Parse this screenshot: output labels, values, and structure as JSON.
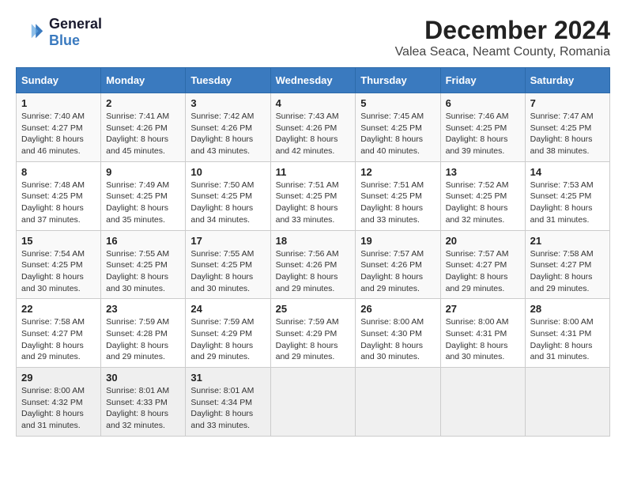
{
  "header": {
    "logo_line1": "General",
    "logo_line2": "Blue",
    "title": "December 2024",
    "subtitle": "Valea Seaca, Neamt County, Romania"
  },
  "weekdays": [
    "Sunday",
    "Monday",
    "Tuesday",
    "Wednesday",
    "Thursday",
    "Friday",
    "Saturday"
  ],
  "weeks": [
    [
      {
        "day": 1,
        "sunrise": "7:40 AM",
        "sunset": "4:27 PM",
        "daylight": "8 hours and 46 minutes."
      },
      {
        "day": 2,
        "sunrise": "7:41 AM",
        "sunset": "4:26 PM",
        "daylight": "8 hours and 45 minutes."
      },
      {
        "day": 3,
        "sunrise": "7:42 AM",
        "sunset": "4:26 PM",
        "daylight": "8 hours and 43 minutes."
      },
      {
        "day": 4,
        "sunrise": "7:43 AM",
        "sunset": "4:26 PM",
        "daylight": "8 hours and 42 minutes."
      },
      {
        "day": 5,
        "sunrise": "7:45 AM",
        "sunset": "4:25 PM",
        "daylight": "8 hours and 40 minutes."
      },
      {
        "day": 6,
        "sunrise": "7:46 AM",
        "sunset": "4:25 PM",
        "daylight": "8 hours and 39 minutes."
      },
      {
        "day": 7,
        "sunrise": "7:47 AM",
        "sunset": "4:25 PM",
        "daylight": "8 hours and 38 minutes."
      }
    ],
    [
      {
        "day": 8,
        "sunrise": "7:48 AM",
        "sunset": "4:25 PM",
        "daylight": "8 hours and 37 minutes."
      },
      {
        "day": 9,
        "sunrise": "7:49 AM",
        "sunset": "4:25 PM",
        "daylight": "8 hours and 35 minutes."
      },
      {
        "day": 10,
        "sunrise": "7:50 AM",
        "sunset": "4:25 PM",
        "daylight": "8 hours and 34 minutes."
      },
      {
        "day": 11,
        "sunrise": "7:51 AM",
        "sunset": "4:25 PM",
        "daylight": "8 hours and 33 minutes."
      },
      {
        "day": 12,
        "sunrise": "7:51 AM",
        "sunset": "4:25 PM",
        "daylight": "8 hours and 33 minutes."
      },
      {
        "day": 13,
        "sunrise": "7:52 AM",
        "sunset": "4:25 PM",
        "daylight": "8 hours and 32 minutes."
      },
      {
        "day": 14,
        "sunrise": "7:53 AM",
        "sunset": "4:25 PM",
        "daylight": "8 hours and 31 minutes."
      }
    ],
    [
      {
        "day": 15,
        "sunrise": "7:54 AM",
        "sunset": "4:25 PM",
        "daylight": "8 hours and 30 minutes."
      },
      {
        "day": 16,
        "sunrise": "7:55 AM",
        "sunset": "4:25 PM",
        "daylight": "8 hours and 30 minutes."
      },
      {
        "day": 17,
        "sunrise": "7:55 AM",
        "sunset": "4:25 PM",
        "daylight": "8 hours and 30 minutes."
      },
      {
        "day": 18,
        "sunrise": "7:56 AM",
        "sunset": "4:26 PM",
        "daylight": "8 hours and 29 minutes."
      },
      {
        "day": 19,
        "sunrise": "7:57 AM",
        "sunset": "4:26 PM",
        "daylight": "8 hours and 29 minutes."
      },
      {
        "day": 20,
        "sunrise": "7:57 AM",
        "sunset": "4:27 PM",
        "daylight": "8 hours and 29 minutes."
      },
      {
        "day": 21,
        "sunrise": "7:58 AM",
        "sunset": "4:27 PM",
        "daylight": "8 hours and 29 minutes."
      }
    ],
    [
      {
        "day": 22,
        "sunrise": "7:58 AM",
        "sunset": "4:27 PM",
        "daylight": "8 hours and 29 minutes."
      },
      {
        "day": 23,
        "sunrise": "7:59 AM",
        "sunset": "4:28 PM",
        "daylight": "8 hours and 29 minutes."
      },
      {
        "day": 24,
        "sunrise": "7:59 AM",
        "sunset": "4:29 PM",
        "daylight": "8 hours and 29 minutes."
      },
      {
        "day": 25,
        "sunrise": "7:59 AM",
        "sunset": "4:29 PM",
        "daylight": "8 hours and 29 minutes."
      },
      {
        "day": 26,
        "sunrise": "8:00 AM",
        "sunset": "4:30 PM",
        "daylight": "8 hours and 30 minutes."
      },
      {
        "day": 27,
        "sunrise": "8:00 AM",
        "sunset": "4:31 PM",
        "daylight": "8 hours and 30 minutes."
      },
      {
        "day": 28,
        "sunrise": "8:00 AM",
        "sunset": "4:31 PM",
        "daylight": "8 hours and 31 minutes."
      }
    ],
    [
      {
        "day": 29,
        "sunrise": "8:00 AM",
        "sunset": "4:32 PM",
        "daylight": "8 hours and 31 minutes."
      },
      {
        "day": 30,
        "sunrise": "8:01 AM",
        "sunset": "4:33 PM",
        "daylight": "8 hours and 32 minutes."
      },
      {
        "day": 31,
        "sunrise": "8:01 AM",
        "sunset": "4:34 PM",
        "daylight": "8 hours and 33 minutes."
      },
      null,
      null,
      null,
      null
    ]
  ]
}
